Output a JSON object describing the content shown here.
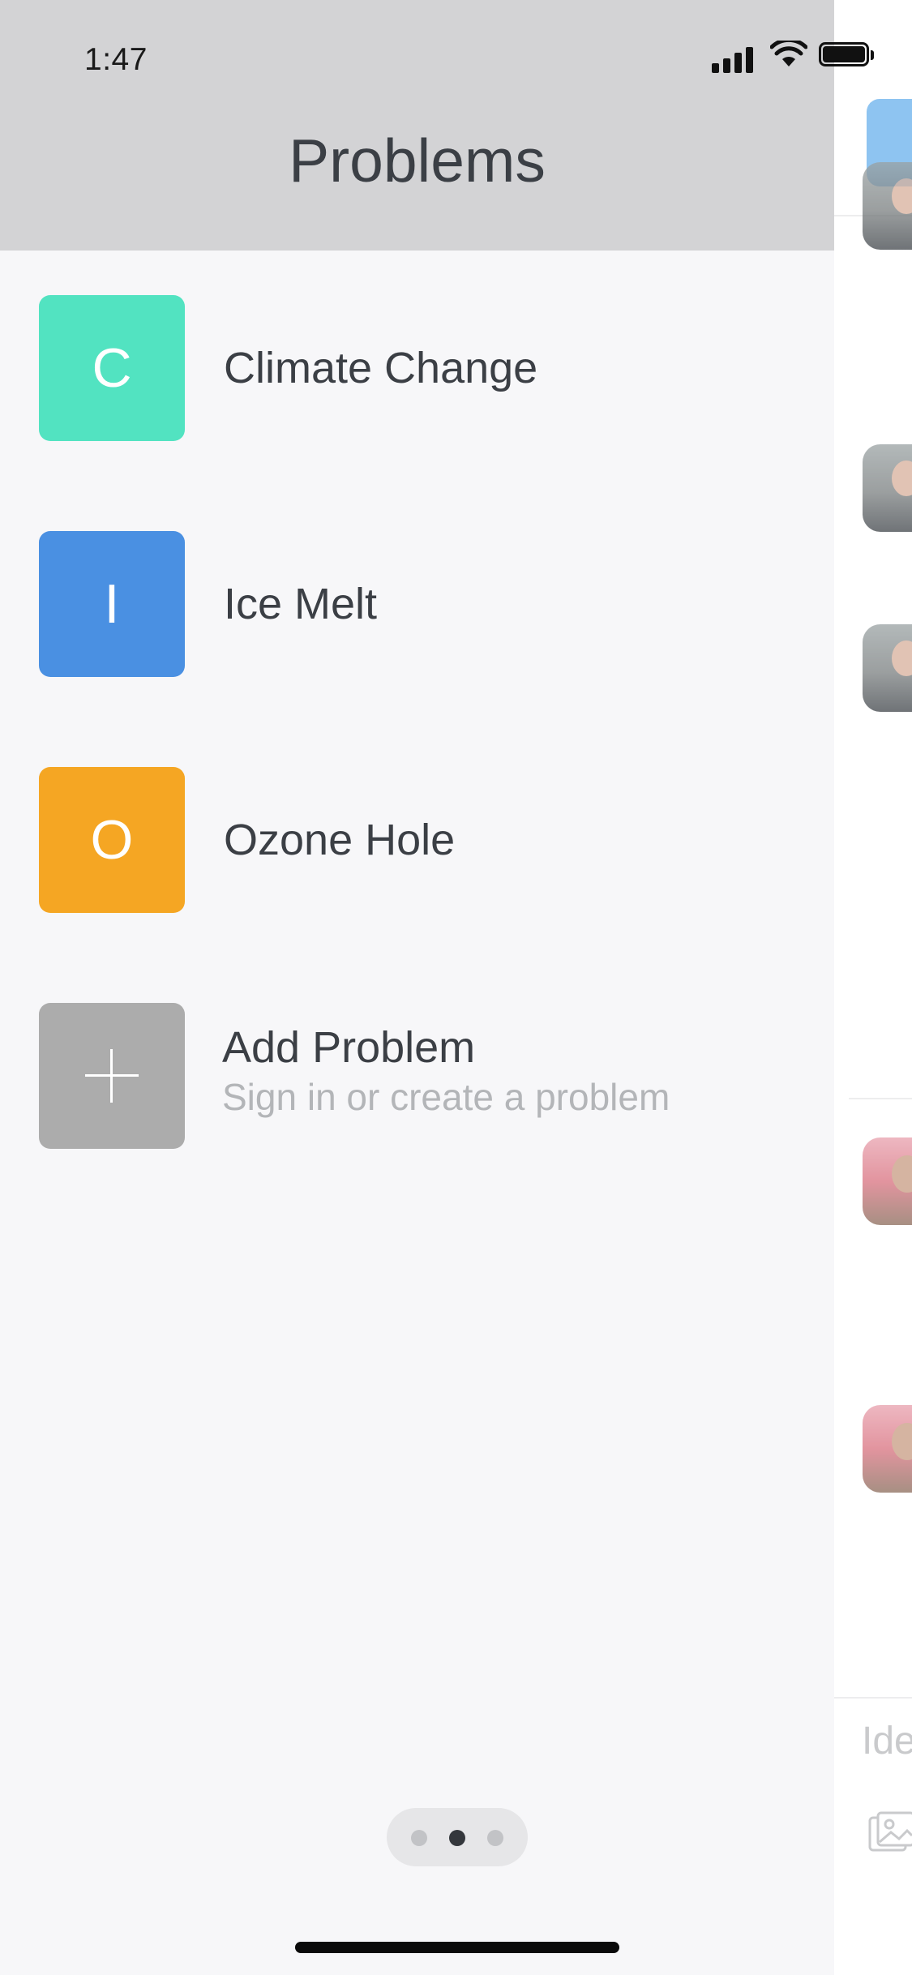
{
  "status_bar": {
    "time": "1:47"
  },
  "drawer": {
    "title": "Problems",
    "items": [
      {
        "initial": "C",
        "label": "Climate Change",
        "color": "#52e3c1"
      },
      {
        "initial": "I",
        "label": "Ice Melt",
        "color": "#4a90e2"
      },
      {
        "initial": "O",
        "label": "Ozone Hole",
        "color": "#f5a623"
      }
    ],
    "add_item": {
      "title": "Add Problem",
      "subtitle": "Sign in or create a problem",
      "color": "#acacac",
      "icon": "plus-icon"
    },
    "page_indicator": {
      "count": 3,
      "active_index": 1
    }
  },
  "background_screen": {
    "input_placeholder": "Ide",
    "attach_icon": "image-icon"
  },
  "colors": {
    "header_bg": "#d3d3d5",
    "drawer_bg": "#f7f7f9",
    "text": "#3b3f45",
    "subtext": "#b3b5b8"
  }
}
